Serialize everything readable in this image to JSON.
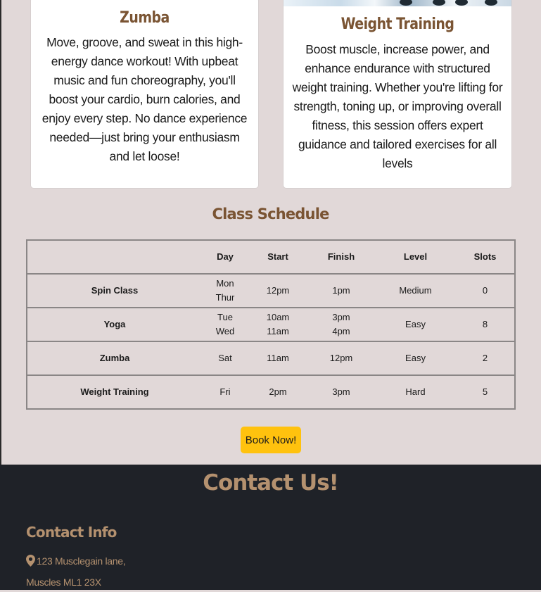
{
  "cards": {
    "zumba": {
      "title": "Zumba",
      "text": "Move, groove, and sweat in this high-energy dance workout! With upbeat music and fun choreography, you'll boost your cardio, burn calories, and enjoy every step. No dance experience needed—just bring your enthusiasm and let loose!"
    },
    "weight": {
      "title": "Weight Training",
      "text": "Boost muscle, increase power, and enhance endurance with structured weight training. Whether you're lifting for strength, toning up, or improving overall fitness, this session offers expert guidance and tailored exercises for all levels"
    }
  },
  "schedule": {
    "title": "Class Schedule",
    "headers": {
      "name": "",
      "day": "Day",
      "start": "Start",
      "finish": "Finish",
      "level": "Level",
      "slots": "Slots"
    },
    "rows": [
      {
        "name": "Spin Class",
        "day1": "Mon",
        "day2": "Thur",
        "start1": "12pm",
        "start2": "",
        "finish1": "1pm",
        "finish2": "",
        "level": "Medium",
        "slots": "0"
      },
      {
        "name": "Yoga",
        "day1": "Tue",
        "day2": "Wed",
        "start1": "10am",
        "start2": "11am",
        "finish1": "3pm",
        "finish2": "4pm",
        "level": "Easy",
        "slots": "8"
      },
      {
        "name": "Zumba",
        "day1": "Sat",
        "day2": "",
        "start1": "11am",
        "start2": "",
        "finish1": "12pm",
        "finish2": "",
        "level": "Easy",
        "slots": "2"
      },
      {
        "name": "Weight Training",
        "day1": "Fri",
        "day2": "",
        "start1": "2pm",
        "start2": "",
        "finish1": "3pm",
        "finish2": "",
        "level": "Hard",
        "slots": "5"
      }
    ]
  },
  "book_button": {
    "label": "Book Now!"
  },
  "footer": {
    "title": "Contact Us!",
    "info_title": "Contact Info",
    "address_line1": "123 Musclegain lane,",
    "address_line2": "Muscles ML1 23X",
    "icon": "map-pin-icon"
  },
  "colors": {
    "page_bg": "#e1d8d8",
    "brand_brown": "#7a5433",
    "footer_bg": "#1f2228",
    "footer_text": "#b4916f",
    "button": "#ffc20e"
  }
}
